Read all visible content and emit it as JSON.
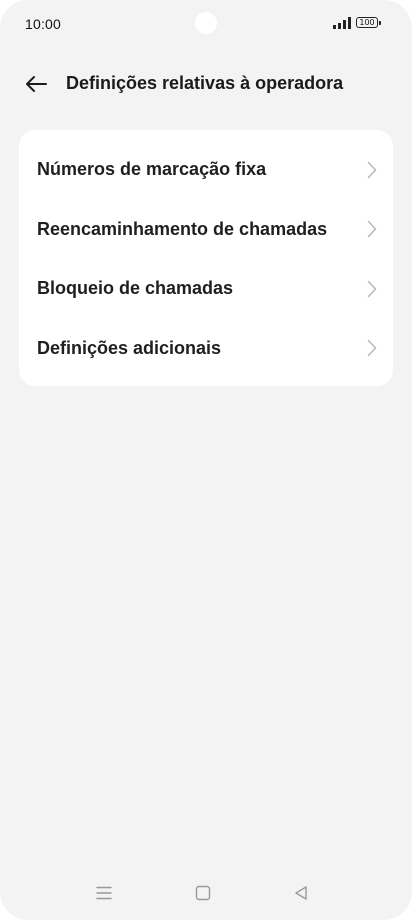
{
  "status_bar": {
    "time": "10:00",
    "battery_level": "100",
    "signal_icon": "signal-bars-icon"
  },
  "header": {
    "back_icon": "arrow-left-icon",
    "title": "Definições relativas à operadora"
  },
  "menu": {
    "items": [
      {
        "label": "Números de marcação fixa",
        "icon": "chevron-right-icon"
      },
      {
        "label": "Reencaminhamento de chamadas",
        "icon": "chevron-right-icon"
      },
      {
        "label": "Bloqueio de chamadas",
        "icon": "chevron-right-icon"
      },
      {
        "label": "Definições adicionais",
        "icon": "chevron-right-icon"
      }
    ]
  },
  "nav_bar": {
    "icons": [
      "menu-lines-icon",
      "home-square-icon",
      "back-triangle-icon"
    ]
  },
  "colors": {
    "background": "#f3f3f3",
    "card": "#ffffff",
    "text": "#1f1f1f",
    "chevron": "#b8b8b8"
  }
}
